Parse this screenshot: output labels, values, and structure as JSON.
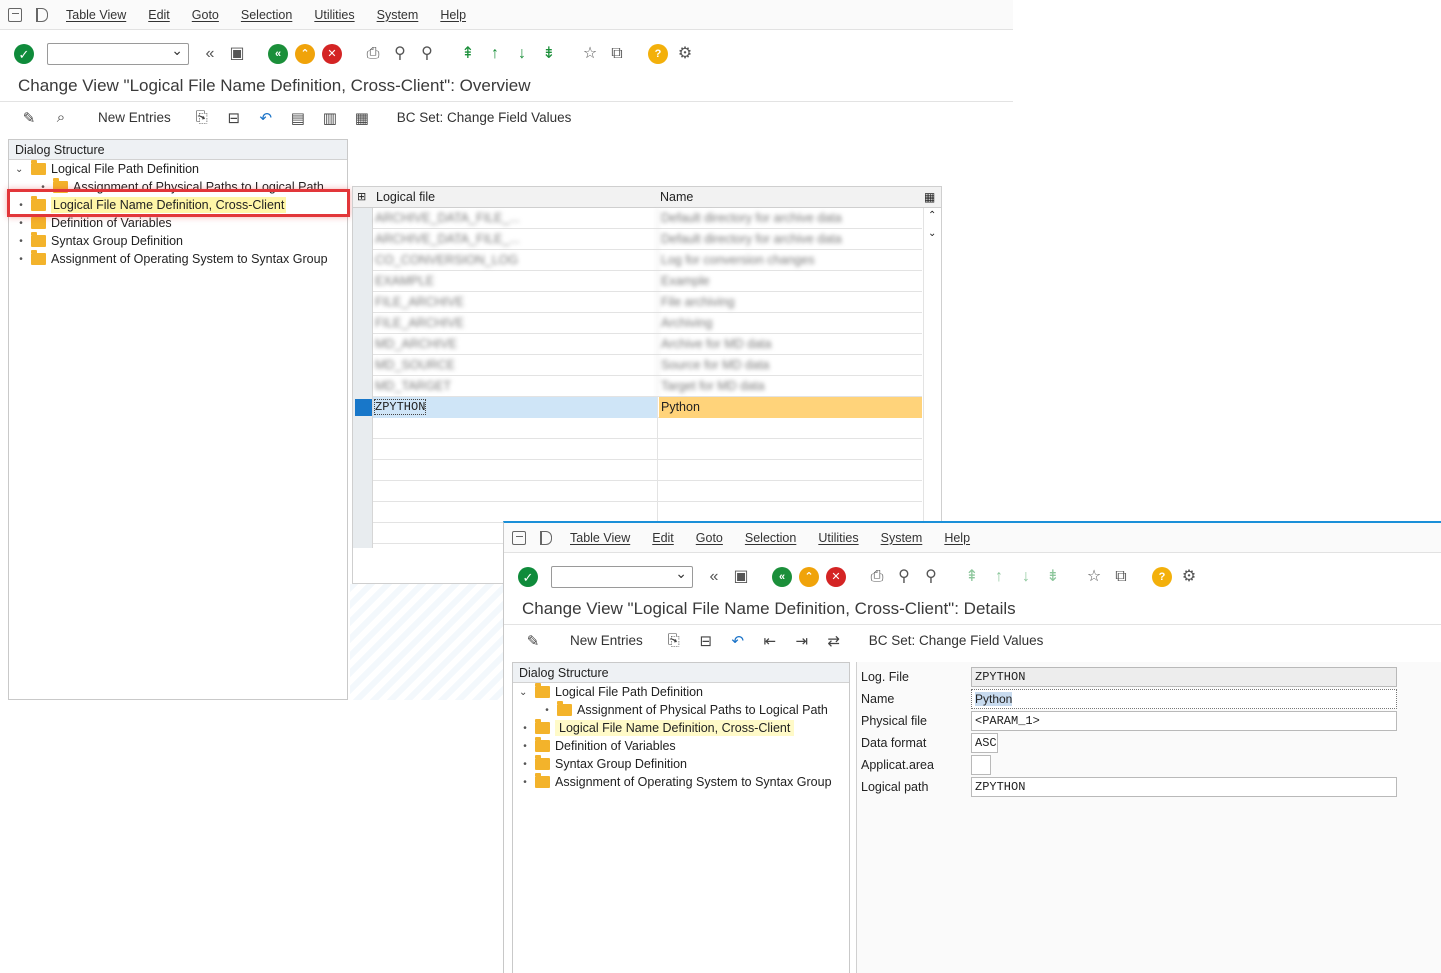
{
  "menu": [
    "Table View",
    "Edit",
    "Goto",
    "Selection",
    "Utilities",
    "System",
    "Help"
  ],
  "overview": {
    "title": "Change View \"Logical File Name Definition, Cross-Client\": Overview",
    "new_entries": "New Entries",
    "bc_set": "BC Set: Change Field Values",
    "tree": {
      "header": "Dialog Structure",
      "items": [
        "Logical File Path Definition",
        "Assignment of Physical Paths to Logical Path",
        "Logical File Name Definition, Cross-Client",
        "Definition of Variables",
        "Syntax Group Definition",
        "Assignment of Operating System to Syntax Group"
      ]
    },
    "table": {
      "columns": [
        "Logical file",
        "Name"
      ],
      "blurred_rows": [
        [
          "ARCHIVE_DATA_FILE_...",
          "Default directory for archive data"
        ],
        [
          "ARCHIVE_DATA_FILE_...",
          "Default directory for archive data"
        ],
        [
          "CO_CONVERSION_LOG",
          "Log for conversion changes"
        ],
        [
          "EXAMPLE",
          "Example"
        ],
        [
          "FILE_ARCHIVE",
          "File archiving"
        ],
        [
          "FILE_ARCHIVE",
          "Archiving"
        ],
        [
          "MD_ARCHIVE",
          "Archive for MD data"
        ],
        [
          "MD_SOURCE",
          "Source for MD data"
        ],
        [
          "MD_TARGET",
          "Target for MD data"
        ]
      ],
      "selected_row": {
        "logical_file": "ZPYTHON",
        "name": "Python"
      }
    }
  },
  "details": {
    "title": "Change View \"Logical File Name Definition, Cross-Client\": Details",
    "new_entries": "New Entries",
    "bc_set": "BC Set: Change Field Values",
    "tree": {
      "header": "Dialog Structure",
      "items": [
        "Logical File Path Definition",
        "Assignment of Physical Paths to Logical Path",
        "Logical File Name Definition, Cross-Client",
        "Definition of Variables",
        "Syntax Group Definition",
        "Assignment of Operating System to Syntax Group"
      ]
    },
    "fields": {
      "log_file": {
        "label": "Log. File",
        "value": "ZPYTHON"
      },
      "name": {
        "label": "Name",
        "value": "Python"
      },
      "physical_file": {
        "label": "Physical file",
        "value": "<PARAM_1>"
      },
      "data_format": {
        "label": "Data format",
        "value": "ASC"
      },
      "applicat_area": {
        "label": "Applicat.area",
        "value": ""
      },
      "logical_path": {
        "label": "Logical path",
        "value": "ZPYTHON"
      }
    }
  },
  "colors": {
    "accent": "#1a8fd8",
    "highlight_box": "#e2363a",
    "selected_name": "#ffd37a",
    "selected_key": "#cfe5f7"
  }
}
